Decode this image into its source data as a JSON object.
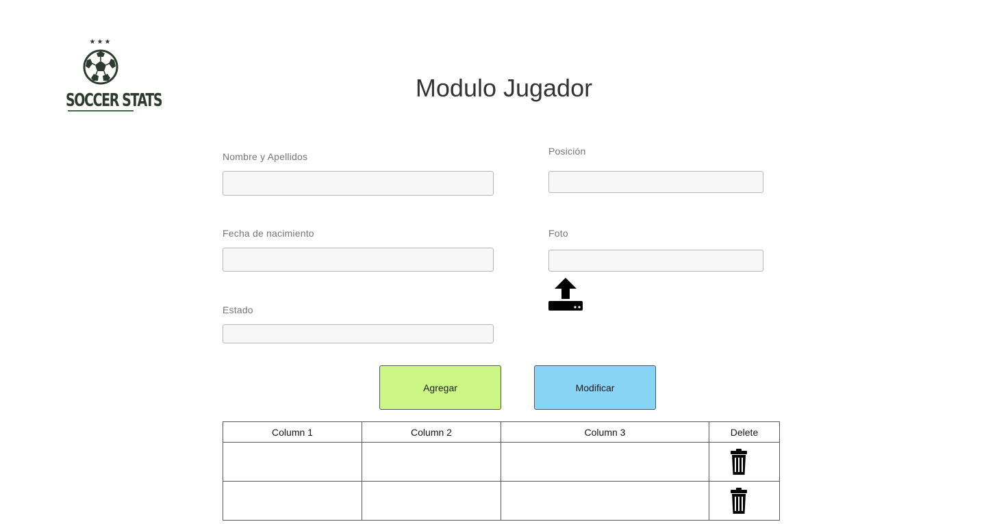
{
  "logo": {
    "stars": "★★★",
    "text": "SOCCER STATS",
    "icon": "soccer-ball-icon"
  },
  "page_title": "Modulo Jugador",
  "form": {
    "name": {
      "label": "Nombre y Apellidos",
      "value": "",
      "placeholder": ""
    },
    "position": {
      "label": "Posición",
      "value": "",
      "placeholder": ""
    },
    "birthdate": {
      "label": "Fecha de nacimiento",
      "value": "",
      "placeholder": ""
    },
    "photo": {
      "label": "Foto",
      "value": "",
      "placeholder": "",
      "upload_icon": "upload-icon"
    },
    "status": {
      "label": "Estado",
      "value": "",
      "placeholder": ""
    }
  },
  "buttons": {
    "add": "Agregar",
    "modify": "Modificar"
  },
  "colors": {
    "add_button": "#ccf785",
    "modify_button": "#87d4f7",
    "logo_dark": "#2d3a2e",
    "logo_green": "#3e6b3f"
  },
  "table": {
    "columns": [
      "Column 1",
      "Column 2",
      "Column 3",
      "Delete"
    ],
    "rows": [
      {
        "col1": "",
        "col2": "",
        "col3": "",
        "delete_icon": "trash-icon"
      },
      {
        "col1": "",
        "col2": "",
        "col3": "",
        "delete_icon": "trash-icon"
      }
    ]
  }
}
